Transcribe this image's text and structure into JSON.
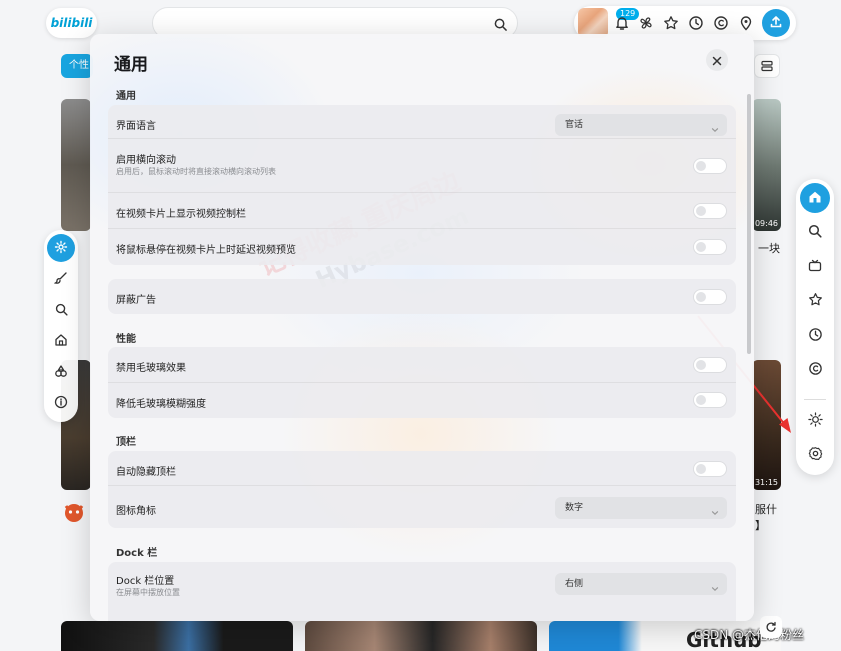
{
  "header": {
    "logo": "bilibili",
    "search_placeholder": "",
    "notification_count": "129"
  },
  "background": {
    "chip_label": "个性",
    "card_right_1_duration": "09:46",
    "card_right_2_duration": "31:15",
    "snippet_1": "一块",
    "snippet_2": "服什",
    "snippet_3": "】",
    "bottom_card_text": "Github",
    "csdn_watermark": "CSDN @杰伦的粉丝"
  },
  "dialog": {
    "title": "通用",
    "sections": {
      "general": {
        "title": "通用",
        "language_label": "界面语言",
        "language_value": "官话",
        "horizontal_scroll_label": "启用横向滚动",
        "horizontal_scroll_desc": "启用后，鼠标滚动时将直接滚动横向滚动列表",
        "video_controls_label": "在视频卡片上显示视频控制栏",
        "hover_delay_label": "将鼠标悬停在视频卡片上时延迟视频预览"
      },
      "ads": {
        "block_ads_label": "屏蔽广告"
      },
      "performance": {
        "title": "性能",
        "disable_frosted_label": "禁用毛玻璃效果",
        "reduce_blur_label": "降低毛玻璃模糊强度"
      },
      "topbar": {
        "title": "顶栏",
        "auto_hide_label": "自动隐藏顶栏",
        "icon_badge_label": "图标角标",
        "icon_badge_value": "数字"
      },
      "dock": {
        "title": "Dock 栏",
        "position_label": "Dock 栏位置",
        "position_desc": "在屏幕中摆放位置",
        "position_value": "右侧"
      }
    }
  },
  "watermark": {
    "text_1": "记得收藏 重庆周边",
    "text_2": "Hybase.com"
  },
  "colors": {
    "accent": "#1fa0e0",
    "arrow": "#e8322f"
  }
}
